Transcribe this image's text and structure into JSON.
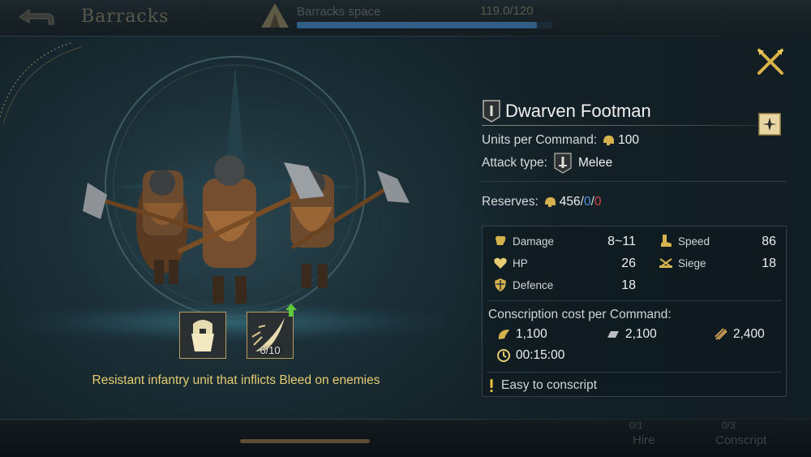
{
  "background": {
    "screen_title": "Barracks",
    "space_label": "Barracks space",
    "space_value": "119.0/120",
    "space_fill_fraction": 0.94,
    "hire_label": "Hire",
    "conscript_label": "Conscript",
    "hire_count": "0/1",
    "conscript_count": "0/3"
  },
  "unit": {
    "name": "Dwarven Footman",
    "rank_icon": "rank-i-badge-icon",
    "units_per_command_label": "Units per Command:",
    "units_per_command_value": "100",
    "attack_type_label": "Attack type:",
    "attack_type_value": "Melee",
    "reserves_label": "Reserves:",
    "reserves_value": "456",
    "reserves_blue": "0",
    "reserves_red": "0",
    "reserves_sep": "/",
    "description": "Resistant infantry unit that inflicts Bleed on enemies"
  },
  "skills": [
    {
      "icon": "dwarf-portrait-icon"
    },
    {
      "icon": "bleed-slash-icon",
      "progress": "6/10",
      "upgrade_available": true
    }
  ],
  "stats": {
    "damage_label": "Damage",
    "damage_value": "8~11",
    "hp_label": "HP",
    "hp_value": "26",
    "defence_label": "Defence",
    "defence_value": "18",
    "speed_label": "Speed",
    "speed_value": "86",
    "siege_label": "Siege",
    "siege_value": "18"
  },
  "cost": {
    "title": "Conscription cost per Command:",
    "food": "1,100",
    "iron": "2,100",
    "wood": "2,400",
    "time": "00:15:00"
  },
  "note": "Easy to conscript",
  "colors": {
    "gold": "#e6cc72",
    "blue": "#4d8fe0",
    "red": "#d2454a",
    "accent": "#c9a85a"
  }
}
